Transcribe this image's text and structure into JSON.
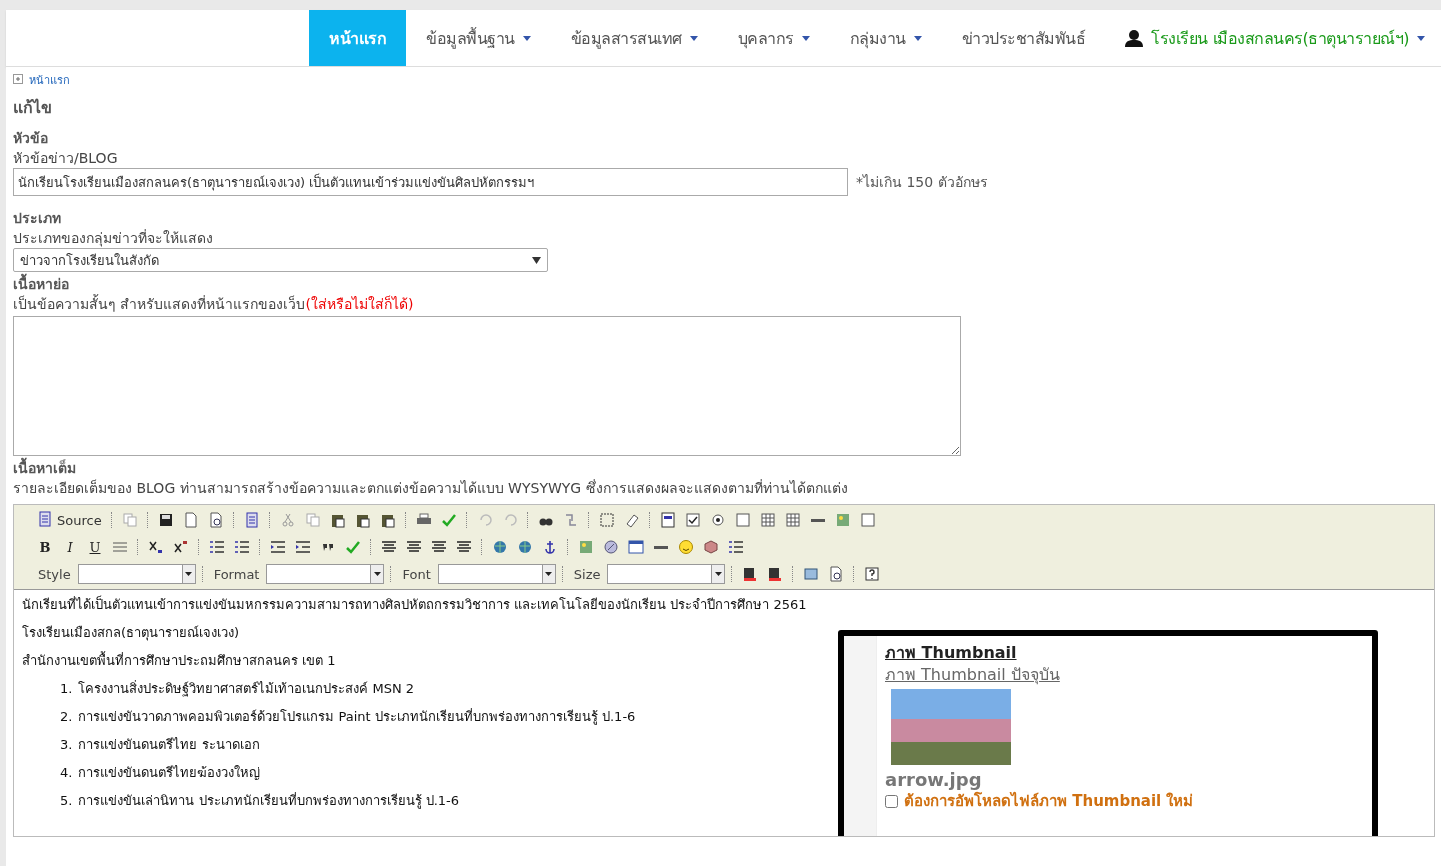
{
  "nav": {
    "items": [
      {
        "label": "หน้าแรก",
        "selected": true,
        "dropdown": false
      },
      {
        "label": "ข้อมูลพื้นฐาน",
        "selected": false,
        "dropdown": true
      },
      {
        "label": "ข้อมูลสารสนเทศ",
        "selected": false,
        "dropdown": true
      },
      {
        "label": "บุคลากร",
        "selected": false,
        "dropdown": true
      },
      {
        "label": "กลุ่มงาน",
        "selected": false,
        "dropdown": true
      },
      {
        "label": "ข่าวประชาสัมพันธ์",
        "selected": false,
        "dropdown": false
      }
    ],
    "user": {
      "label": "โรงเรียน เมืองสกลนคร(ธาตุนารายณ์ฯ)",
      "dropdown": true
    }
  },
  "breadcrumb": "หน้าแรก",
  "page_title": "แก้ไข",
  "headline": {
    "heading": "หัวข้อ",
    "label": "หัวข้อข่าว/BLOG",
    "value": "นักเรียนโรงเรียนเมืองสกลนคร(ธาตุนารายณ์เจงเวง) เป็นตัวแทนเข้าร่วมแข่งขันศิลปหัตกรรมฯ",
    "note": "*ไม่เกิน 150 ตัวอักษร"
  },
  "category": {
    "heading": "ประเภท",
    "label": "ประเภทของกลุ่มข่าวที่จะให้แสดง",
    "value": "ข่าวจากโรงเรียนในสังกัด"
  },
  "summary": {
    "heading": "เนื้อหาย่อ",
    "label": "เป็นข้อความสั้นๆ สำหรับแสดงที่หน้าแรกของเว็บ",
    "optional": "(ใส่หรือไม่ใส่ก็ได้)"
  },
  "full_content": {
    "heading": "เนื้อหาเต็ม",
    "label": "รายละเอียดเต็มของ BLOG ท่านสามารถสร้างข้อความและตกแต่งข้อความได้แบบ WYSYWYG ซึ่งการแสดงผลจะแสดงตามที่ท่านได้ตกแต่ง"
  },
  "editor": {
    "source_label": "Source",
    "format_buttons": [
      "B",
      "I",
      "U"
    ],
    "dropdowns": [
      {
        "label": "Style"
      },
      {
        "label": "Format"
      },
      {
        "label": "Font"
      },
      {
        "label": "Size"
      }
    ],
    "paragraphs": [
      "นักเรียนที่ได้เป็นตัวแทนเข้าการแข่งขันมหกรรมความสามารถทางศิลปหัตถกรรมวิชาการ และเทคโนโลยีของนักเรียน ประจำปีการศึกษา 2561",
      "โรงเรียนเมืองสกล(ธาตุนารายณ์เจงเวง)",
      "สำนักงานเขตพื้นที่การศึกษาประถมศึกษาสกลนคร เขต 1"
    ],
    "list": [
      {
        "number": "1.",
        "text": "โครงงานสิ่งประดิษฐ์วิทยาศาสตร์ไม้เท้าอเนกประสงค์ MSN 2"
      },
      {
        "number": "2.",
        "text": "การแข่งขันวาดภาพคอมพิวเตอร์ด้วยโปรแกรม Paint ประเภทนักเรียนที่บกพร่องทางการเรียนรู้ ป.1-6"
      },
      {
        "number": "3.",
        "text": "การแข่งขันดนตรีไทย ระนาดเอก"
      },
      {
        "number": "4.",
        "text": "การแข่งขันดนตรีไทยฆ้องวงใหญ่"
      },
      {
        "number": "5.",
        "text": "การแข่งขันเล่านิทาน ประเภทนักเรียนที่บกพร่องทางการเรียนรู้ ป.1-6"
      }
    ]
  },
  "thumbnail": {
    "heading": "ภาพ Thumbnail",
    "current_label": "ภาพ Thumbnail ปัจจุบัน",
    "filename": "arrow.jpg",
    "upload": {
      "label": "ต้องการอัพโหลดไฟล์ภาพ Thumbnail ใหม่",
      "checked": false
    }
  }
}
